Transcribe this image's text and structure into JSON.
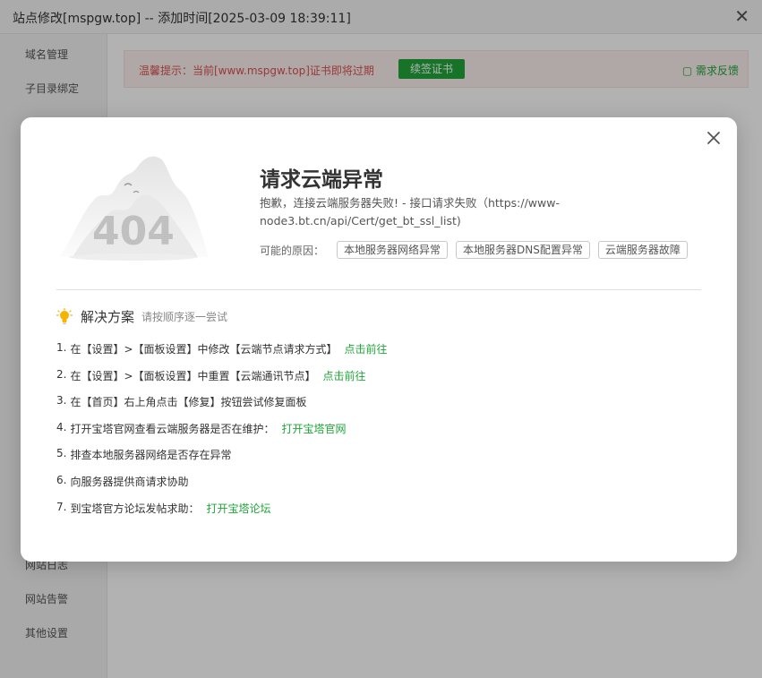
{
  "background": {
    "title": "站点修改[mspgw.top] -- 添加时间[2025-03-09 18:39:11]",
    "sidebar_items_top": [
      "域名管理",
      "子目录绑定"
    ],
    "sidebar_items_bottom": [
      "网站日志",
      "网站告警",
      "其他设置"
    ],
    "alert_text": "温馨提示：当前[www.mspgw.top]证书即将过期",
    "renew_button": "续签证书",
    "feedback_link": "需求反馈",
    "tabs": [
      "...",
      "..."
    ],
    "bottom_note": "..."
  },
  "modal": {
    "title": "请求云端异常",
    "description": "抱歉，连接云端服务器失败! - 接口请求失败（https://www-node3.bt.cn/api/Cert/get_bt_ssl_list)",
    "reasons_label": "可能的原因：",
    "reasons": [
      "本地服务器网络异常",
      "本地服务器DNS配置异常",
      "云端服务器故障"
    ],
    "solution_title": "解决方案",
    "solution_subtitle": "请按顺序逐一尝试",
    "illustration_text": "404",
    "steps": [
      {
        "num": "1.",
        "text": "在【设置】>【面板设置】中修改【云端节点请求方式】",
        "link": "点击前往"
      },
      {
        "num": "2.",
        "text": "在【设置】>【面板设置】中重置【云端通讯节点】",
        "link": "点击前往"
      },
      {
        "num": "3.",
        "text": "在【首页】右上角点击【修复】按钮尝试修复面板",
        "link": ""
      },
      {
        "num": "4.",
        "text": "打开宝塔官网查看云端服务器是否在维护：",
        "link": "打开宝塔官网"
      },
      {
        "num": "5.",
        "text": "排查本地服务器网络是否存在异常",
        "link": ""
      },
      {
        "num": "6.",
        "text": "向服务器提供商请求协助",
        "link": ""
      },
      {
        "num": "7.",
        "text": "到宝塔官方论坛发帖求助：",
        "link": "打开宝塔论坛"
      }
    ]
  },
  "colors": {
    "accent": "#20a53a",
    "alert_red": "#d9534f",
    "bulb": "#f5b400"
  }
}
